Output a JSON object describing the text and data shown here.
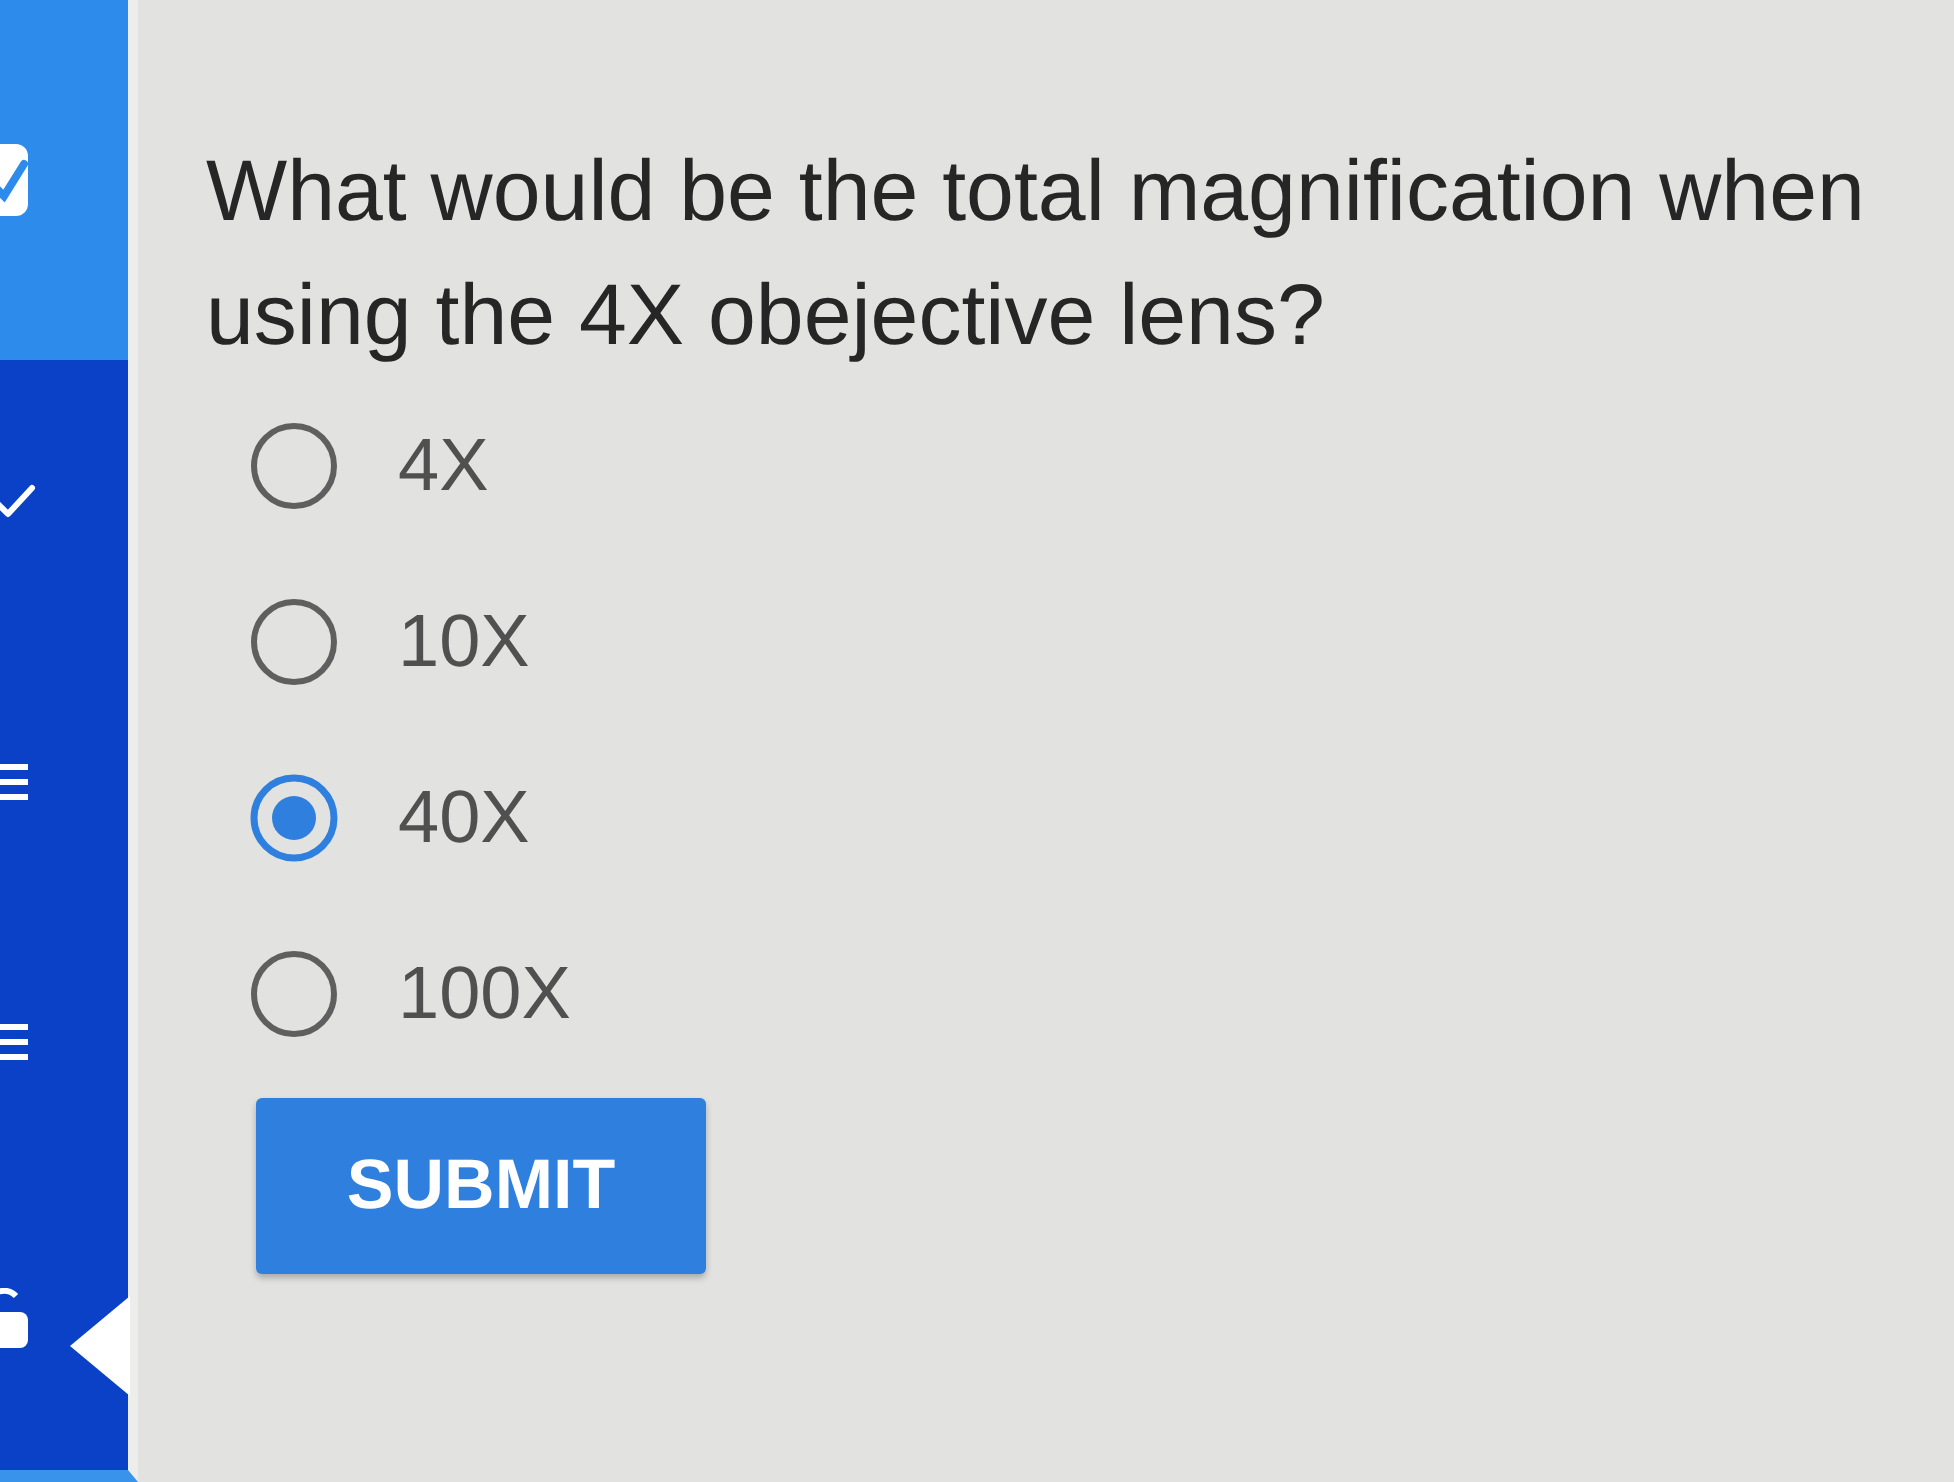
{
  "sidebar": {
    "items": [
      {
        "selected": true
      },
      {
        "selected": false
      },
      {
        "selected": false
      },
      {
        "selected": false
      },
      {
        "selected": false
      }
    ]
  },
  "question": {
    "text": "What would be the total magnification when using the 4X obejective lens?",
    "options": [
      {
        "label": "4X",
        "selected": false
      },
      {
        "label": "10X",
        "selected": false
      },
      {
        "label": "40X",
        "selected": true
      },
      {
        "label": "100X",
        "selected": false
      }
    ]
  },
  "submit_button": {
    "label": "SUBMIT"
  }
}
